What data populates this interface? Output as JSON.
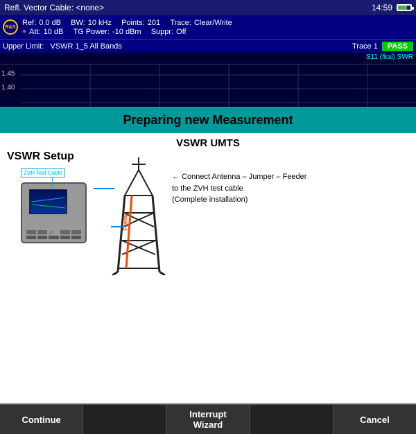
{
  "topbar": {
    "title": "Refl. Vector  Cable: <none>",
    "time": "14:59"
  },
  "params": {
    "logo": "R&S",
    "ref_label": "Ref:",
    "ref_value": "0.0 dB",
    "bw_label": "BW:",
    "bw_value": "10 kHz",
    "points_label": "Points:",
    "points_value": "201",
    "trace_label": "Trace:",
    "trace_value": "Clear/Write",
    "att_label": "Att:",
    "att_value": "10 dB",
    "tg_label": "TG Power:",
    "tg_value": "-10 dBm",
    "suppr_label": "Suppr:",
    "suppr_value": "Off"
  },
  "status": {
    "upper_limit_label": "Upper Limit:",
    "upper_limit_value": "VSWR 1_5 All Bands",
    "trace_num": "Trace 1",
    "pass_label": "PASS",
    "s11_label": "S11 (fkal) SWR"
  },
  "chart": {
    "y_labels": [
      "1.45",
      "1.40"
    ]
  },
  "banner": {
    "text": "Preparing new Measurement"
  },
  "main": {
    "vswr_umts_title": "VSWR UMTS",
    "vswr_setup_label": "VSWR Setup",
    "device_label": "ZVH Test Cable",
    "connect_text": "← Connect Antenna – Jumper – Feeder\nto the ZVH test cable\n(Complete installation)",
    "feeder_label": "Feeder"
  },
  "buttons": {
    "continue": "Continue",
    "interrupt": "Interrupt\nWizard",
    "empty1": "",
    "empty2": "",
    "cancel": "Cancel"
  }
}
